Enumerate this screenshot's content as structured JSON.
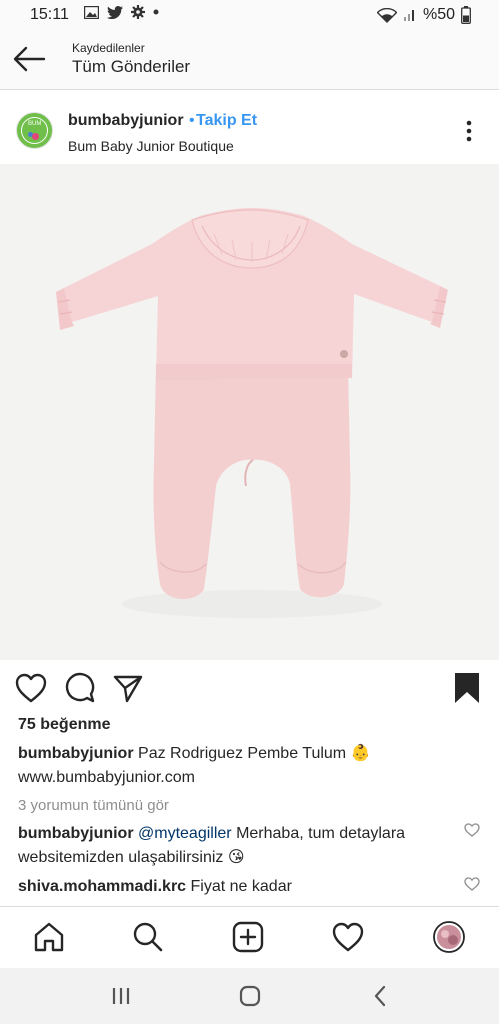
{
  "status_bar": {
    "time": "15:11",
    "battery": "%50",
    "icons": [
      "gallery-icon",
      "twitter-icon",
      "settings-icon",
      "dot-icon",
      "wifi-icon",
      "signal-icon"
    ]
  },
  "header": {
    "subtitle": "Kaydedilenler",
    "title": "Tüm Gönderiler"
  },
  "post": {
    "username": "bumbabyjunior",
    "bullet": "•",
    "follow_label": "Takip Et",
    "location": "Bum Baby Junior Boutique",
    "avatar_text": "BUM",
    "likes": "75 beğenme",
    "caption": {
      "username": "bumbabyjunior",
      "text": "Paz Rodriguez Pembe Tulum 👶",
      "link": "www.bumbabyjunior.com"
    },
    "view_all_comments": "3 yorumun tümünü gör",
    "comments": [
      {
        "username": "bumbabyjunior",
        "mention": "@myteagiller",
        "text": "Merhaba, tum detaylara websitemizden ulaşabilirsiniz 😘"
      },
      {
        "username": "shiva.mohammadi.krc",
        "mention": "",
        "text": "Fiyat ne kadar"
      }
    ]
  },
  "colors": {
    "link_blue": "#3897f0",
    "onesie_pink": "#f6d3d4",
    "text": "#262626",
    "muted": "#8e8e8e"
  },
  "tab_bar": {
    "items": [
      "home-icon",
      "search-icon",
      "add-post-icon",
      "activity-heart-icon",
      "profile-avatar"
    ]
  }
}
